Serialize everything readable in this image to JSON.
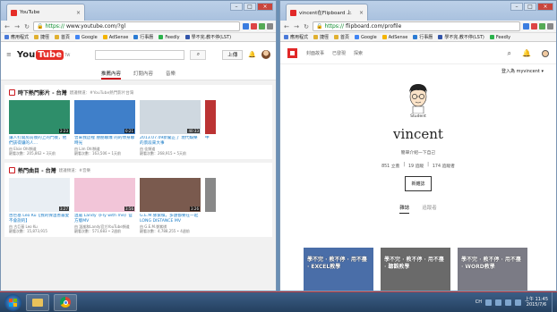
{
  "left_window": {
    "tab_title": "YouTube",
    "url_https": "https://",
    "url_rest": "www.youtube.com/?gl",
    "bookmarks": [
      "應用程式",
      "捷徑",
      "首頁",
      "Google",
      "AdSense",
      "行事曆",
      "Feedly",
      "學不完.教不停(LST)"
    ],
    "logo_you": "You",
    "logo_tube": "Tube",
    "logo_region": "TW",
    "upload_label": "上傳",
    "tabs": [
      "推薦內容",
      "訂閱內容",
      "音樂"
    ],
    "active_tab": 0,
    "shelves": [
      {
        "title": "時下熱門影片 - 台灣",
        "sub": "建議頻道：#YouTube熱門影片台灣",
        "videos": [
          {
            "title": "讓人打開房前後的上的門後，他們該得讓的人…",
            "meta": "由 Elsie Ohl頻道\n觀看次數：205,862 • 3天前",
            "dur": "2:23",
            "color": "#2e8e6a"
          },
          {
            "title": "曾來我這裡 朋朋聯爆 的的你身聯時光",
            "meta": "由 Lim Ohl頻道\n觀看次數：163,506 • 1天前",
            "dur": "0:21",
            "color": "#3f7fc9"
          },
          {
            "title": "2013.07.09新聞正了 現代娛樂的景段來大事",
            "meta": "由 佳頻道\n觀看次數：268,915 • 5天前",
            "dur": "40:33",
            "color": "#cfd8e0"
          },
          {
            "title": "中",
            "meta": "",
            "dur": "",
            "color": "#b33"
          }
        ]
      },
      {
        "title": "熱門曲目 - 台灣",
        "sub": "建議頻道：#音樂",
        "videos": [
          {
            "title": "古巨基 Leo Ku【我的保溫善最愛不會說的】",
            "meta": "由 古巨基 Leo Ku\n觀看次數：15,873,915",
            "dur": "3:27",
            "color": "#e9eef3"
          },
          {
            "title": "溫嵐 Landy《Fly with me》官方版MV",
            "meta": "由 溫嵐和Landy官方YouTube頻道\n觀看次數：571,683 • 2週前",
            "dur": "3:56",
            "color": "#f2c5d8"
          },
          {
            "title": "G.E.M.鄧紫棋，多遠都要在一起 LONG DISTANCE MV",
            "meta": "由 G.E.M.鄧紫棋\n觀看次數：4,788,255 • 4週前",
            "dur": "3:26",
            "color": "#7a5a4e"
          },
          {
            "title": "",
            "meta": "",
            "dur": "",
            "color": "#888"
          }
        ]
      }
    ]
  },
  "right_window": {
    "tab_title": "vincent在Flipboard 上",
    "url_https": "https://",
    "url_rest": "flipboard.com/profile",
    "bookmarks": [
      "應用程式",
      "捷徑",
      "首頁",
      "Google",
      "AdSense",
      "行事曆",
      "學不完.教不停(LST)",
      "Feedly"
    ],
    "nav": [
      "封面故事",
      "已發現",
      "探索"
    ],
    "login_label": "登入為 myvincent ▾",
    "caption": "Student",
    "name": "vincent",
    "bio": "簡單介紹一下自己",
    "stats": [
      "851 立蓋",
      "19 追蹤",
      "174 追蹤者"
    ],
    "edit_label": "新雜誌",
    "tabs": [
      "雜誌",
      "追蹤者"
    ],
    "active_tab": 0,
    "magazines": [
      {
        "title": "學不完 · 教不停 · 用不盡 · EXCEL教學",
        "color": "#4a6ea8"
      },
      {
        "title": "學不完 · 教不停 · 用不盡 · 聽觀教學",
        "color": "#6a6a6a"
      },
      {
        "title": "學不完 · 教不停 · 用不盡 · WORD教學",
        "color": "#7b7b85"
      }
    ]
  },
  "taskbar": {
    "time": "上午 11:45",
    "date": "2015/7/6",
    "lang": "CH"
  }
}
